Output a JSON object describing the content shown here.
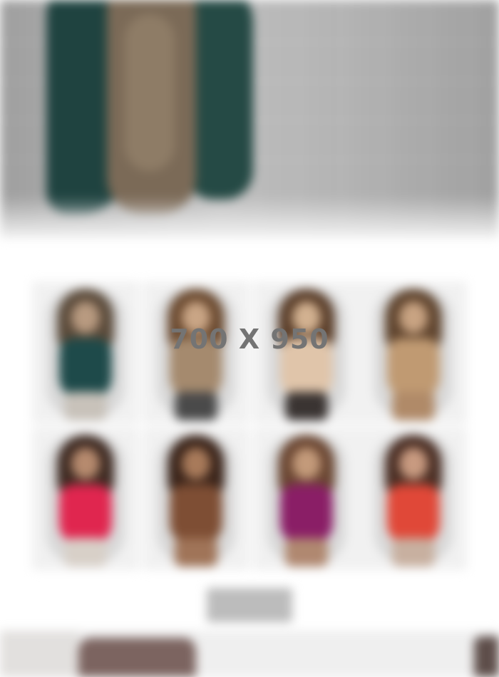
{
  "placeholder": {
    "label": "700 X 950"
  },
  "hero": {
    "image": "hero-model-photo"
  },
  "products": {
    "items": [
      {
        "name": "model-teal",
        "hair": "#5a4a3a",
        "face": "#b89a80",
        "body": "#1e4a4a",
        "legs": "#c8c2ba"
      },
      {
        "name": "model-beige",
        "hair": "#6b4a30",
        "face": "#c9a585",
        "body": "#a58a6e",
        "legs": "#4a4a4a"
      },
      {
        "name": "model-nude",
        "hair": "#5a3e2a",
        "face": "#d2b190",
        "body": "#e0c5aa",
        "legs": "#3a3432"
      },
      {
        "name": "model-tan",
        "hair": "#5f442e",
        "face": "#c8a382",
        "body": "#c09a72",
        "legs": "#b08a68"
      },
      {
        "name": "model-red",
        "hair": "#3e2a22",
        "face": "#b68a6e",
        "body": "#e0264f",
        "legs": "#d8d0c8"
      },
      {
        "name": "model-brown",
        "hair": "#3a241a",
        "face": "#a87a5a",
        "body": "#7e4e34",
        "legs": "#a07458"
      },
      {
        "name": "model-purple",
        "hair": "#6a4632",
        "face": "#c39a7a",
        "body": "#8a1e66",
        "legs": "#b08870"
      },
      {
        "name": "model-coral",
        "hair": "#4a2e24",
        "face": "#c89a80",
        "body": "#e04838",
        "legs": "#c8b0a0"
      }
    ]
  }
}
